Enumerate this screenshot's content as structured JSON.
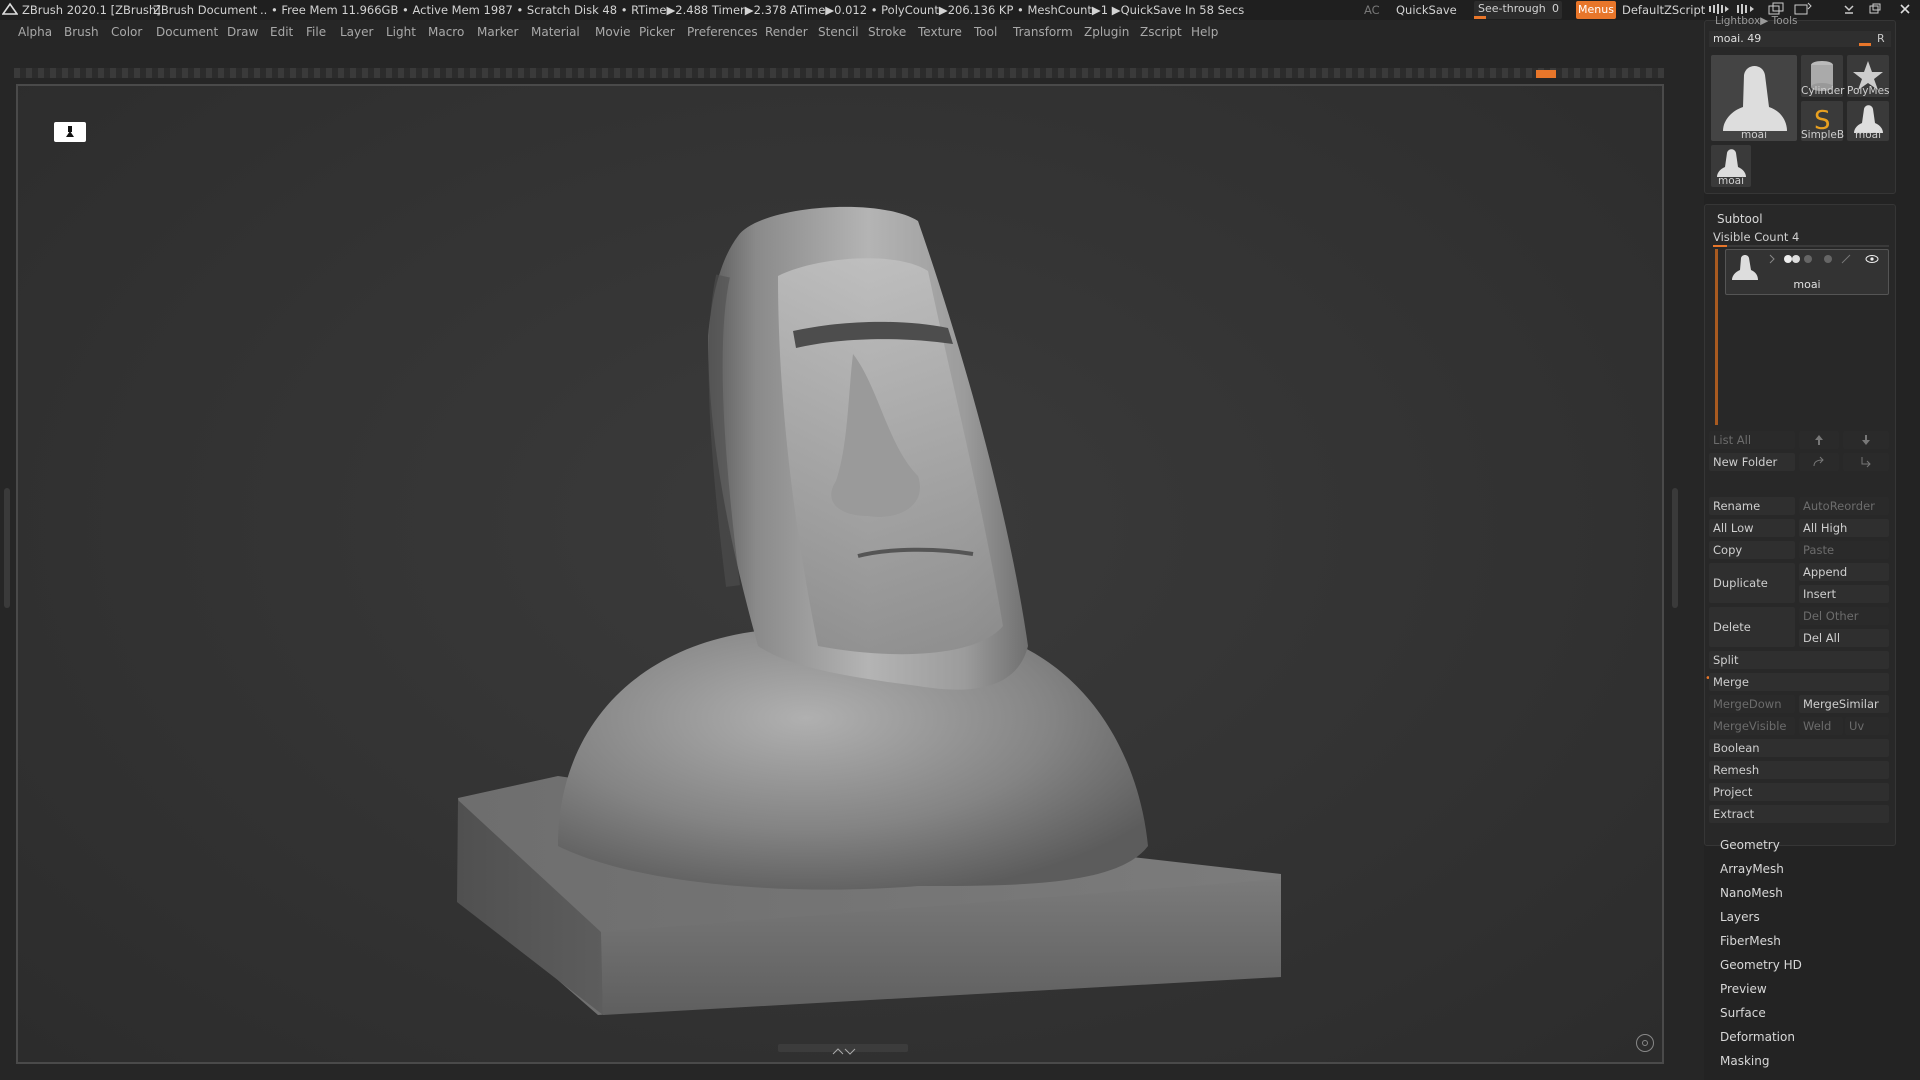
{
  "titlebar": {
    "app": "ZBrush 2020.1 [ZBrush]",
    "document": "ZBrush Document",
    "stats": ".. • Free Mem 11.966GB • Active Mem 1987 • Scratch Disk 48 • RTime▶2.488 Timer▶2.378 ATime▶0.012 • PolyCount▶206.136 KP • MeshCount▶1 ▶QuickSave In 58 Secs",
    "ac": "AC",
    "quicksave": "QuickSave",
    "see_through_label": "See-through",
    "see_through_value": "0",
    "menus": "Menus",
    "script": "DefaultZScript"
  },
  "menubar": {
    "items": [
      "Alpha",
      "Brush",
      "Color",
      "Document",
      "Draw",
      "Edit",
      "File",
      "Layer",
      "Light",
      "Macro",
      "Marker",
      "Material",
      "Movie",
      "Picker",
      "Preferences",
      "Render",
      "Stencil",
      "Stroke",
      "Texture",
      "Tool",
      "Transform",
      "Zplugin",
      "Zscript",
      "Help"
    ]
  },
  "toolpanel": {
    "header": "Lightbox▶ Tools",
    "tool_name": "moai. 49",
    "r_button": "R",
    "thumbs": [
      "moai",
      "Cylinder",
      "PolyMes",
      "SimpleB",
      "moai",
      "moai"
    ]
  },
  "subtool": {
    "title": "Subtool",
    "visible_count": "Visible Count 4",
    "item_name": "moai",
    "list_all": "List All",
    "new_folder": "New Folder",
    "rename": "Rename",
    "autoreorder": "AutoReorder",
    "all_low": "All Low",
    "all_high": "All High",
    "copy": "Copy",
    "paste": "Paste",
    "duplicate": "Duplicate",
    "append": "Append",
    "insert": "Insert",
    "delete": "Delete",
    "del_other": "Del Other",
    "del_all": "Del All",
    "split": "Split",
    "merge": "Merge",
    "merge_down": "MergeDown",
    "merge_similar": "MergeSimilar",
    "merge_visible": "MergeVisible",
    "weld": "Weld",
    "uv": "Uv",
    "boolean": "Boolean",
    "remesh": "Remesh",
    "project": "Project",
    "extract": "Extract"
  },
  "sections": [
    "Geometry",
    "ArrayMesh",
    "NanoMesh",
    "Layers",
    "FiberMesh",
    "Geometry HD",
    "Preview",
    "Surface",
    "Deformation",
    "Masking"
  ],
  "colors": {
    "accent": "#e8762a"
  }
}
